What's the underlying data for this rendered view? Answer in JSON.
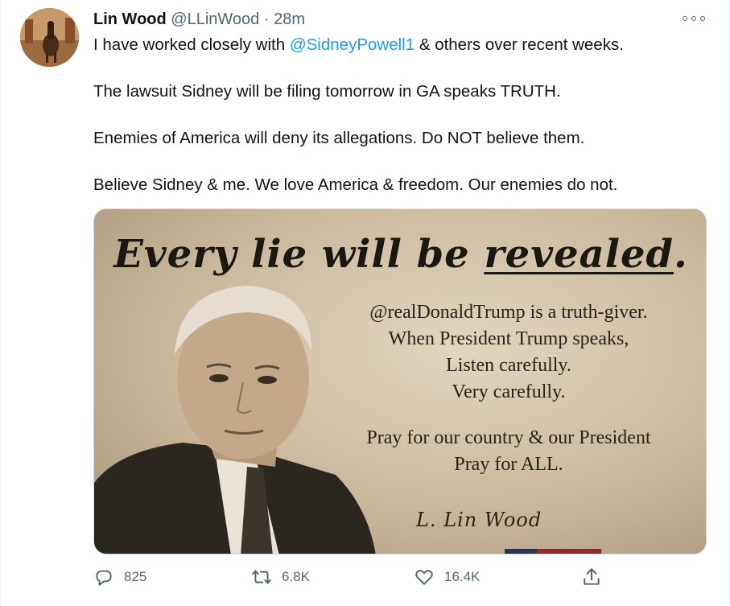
{
  "author": {
    "name": "Lin Wood",
    "handle": "@LLinWood",
    "separator": "·",
    "time": "28m"
  },
  "tweet": {
    "line1_before": "I have worked closely with ",
    "line1_mention": "@SidneyPowell1",
    "line1_after": " & others over recent weeks.",
    "line2": "The lawsuit Sidney will be filing tomorrow in GA speaks TRUTH.",
    "line3": "Enemies of America will deny its allegations. Do NOT believe them.",
    "line4": "Believe Sidney & me. We love America & freedom. Our enemies do not."
  },
  "image": {
    "headline_start": "Every lie will be ",
    "headline_underlined": "revealed",
    "headline_end": ".",
    "body_lines": [
      "@realDonaldTrump is a truth-giver.",
      "When President Trump speaks,",
      "Listen carefully.",
      "Very carefully."
    ],
    "body_lines_2": [
      "Pray for our country & our President",
      "Pray for ALL."
    ],
    "signature": "L. Lin Wood"
  },
  "actions": {
    "reply": {
      "icon": "reply-icon",
      "count": "825"
    },
    "retweet": {
      "icon": "retweet-icon",
      "count": "6.8K"
    },
    "like": {
      "icon": "heart-icon",
      "count": "16.4K"
    },
    "share": {
      "icon": "share-icon"
    }
  },
  "colors": {
    "text": "#0f1419",
    "secondary": "#536471",
    "link": "#1d9bf0",
    "border": "#cfd9de"
  }
}
